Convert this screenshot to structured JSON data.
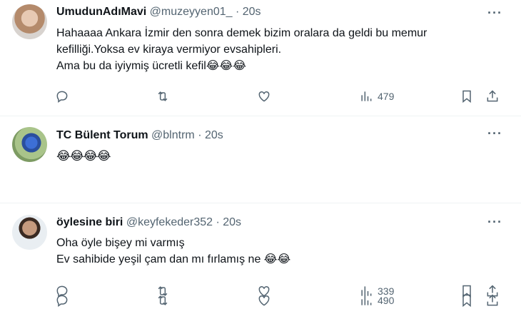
{
  "tweets": [
    {
      "name": "UmudunAdıMavi",
      "handle": "@muzeyyen01_",
      "time": "· 20s",
      "lines": [
        "Hahaaaa Ankara İzmir den sonra demek  bizim oralara da geldi bu memur",
        "kefilliği.Yoksa ev kiraya vermiyor evsahipleri.",
        "Ama bu da iyiymiş ücretli kefil😂😂😂"
      ],
      "views": "479"
    },
    {
      "name": "TC Bülent Torum",
      "handle": "@blntrm",
      "time": "· 20s",
      "lines": [
        "😂😂😂😂"
      ],
      "views": "490"
    },
    {
      "name": "öylesine biri",
      "handle": "@keyfekeder352",
      "time": "· 20s",
      "lines": [
        "Oha öyle bişey mi varmış",
        "Ev sahibide yeşil çam dan mı fırlamış ne  😂😂"
      ],
      "views": "339"
    }
  ],
  "icons": [
    "more-icon",
    "reply-icon",
    "retweet-icon",
    "like-icon",
    "views-icon",
    "bookmark-icon",
    "share-icon"
  ],
  "colors": {
    "text": "#0f1419",
    "muted": "#536471",
    "divider": "#eff3f4"
  }
}
